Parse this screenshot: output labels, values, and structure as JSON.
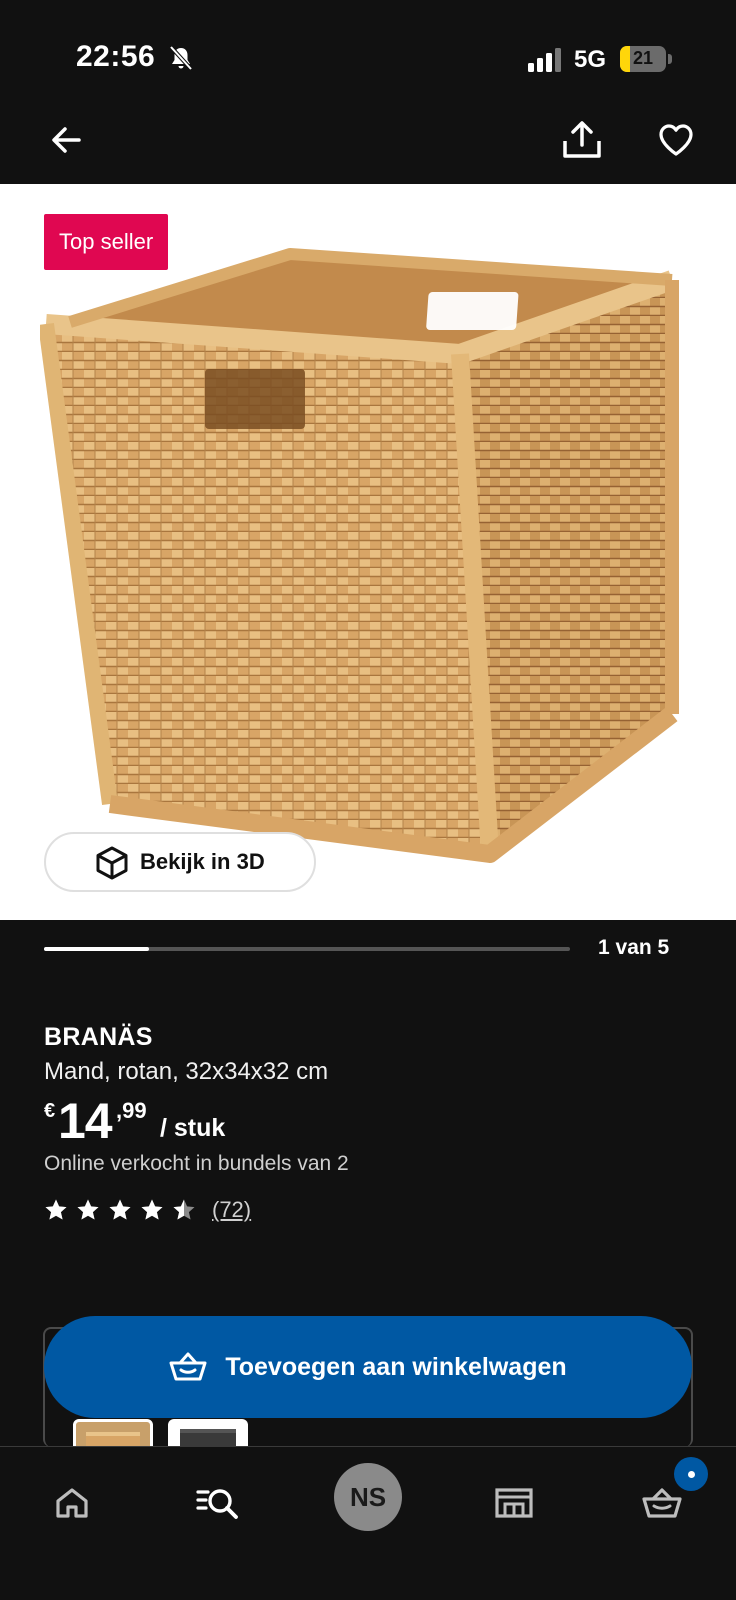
{
  "status_bar": {
    "time": "22:56",
    "network": "5G",
    "battery_level": "21",
    "battery_fraction": 0.21
  },
  "top_nav": {
    "icons": [
      "back-arrow-icon",
      "share-icon",
      "heart-icon"
    ]
  },
  "gallery": {
    "badge": "Top seller",
    "view_3d_label": "Bekijk in 3D",
    "counter": "1 van 5",
    "current_image": 1,
    "total_images": 5
  },
  "product": {
    "name": "BRANÄS",
    "description": "Mand, rotan, 32x34x32 cm",
    "price": {
      "currency": "€",
      "integer": "14",
      "decimal": ",99",
      "unit": "/ stuk"
    },
    "bundle_note": "Online verkocht in bundels van 2",
    "rating_value": 4.5,
    "rating_max": 5,
    "review_count": "(72)"
  },
  "cart": {
    "add_label": "Toevoegen aan winkelwagen"
  },
  "bottom_nav": {
    "avatar_initials": "NS",
    "items": [
      "home-icon",
      "search-list-icon",
      "profile-avatar",
      "store-icon",
      "cart-icon"
    ]
  },
  "colors": {
    "background": "#111111",
    "badge": "#e00751",
    "primary_blue": "#0058a3",
    "battery_yellow": "#ffd60a"
  }
}
